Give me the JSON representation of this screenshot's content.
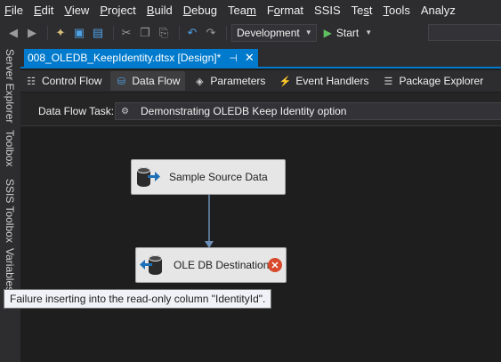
{
  "menu": {
    "items": [
      {
        "pre": "",
        "u": "F",
        "post": "ile"
      },
      {
        "pre": "",
        "u": "E",
        "post": "dit"
      },
      {
        "pre": "",
        "u": "V",
        "post": "iew"
      },
      {
        "pre": "",
        "u": "P",
        "post": "roject"
      },
      {
        "pre": "",
        "u": "B",
        "post": "uild"
      },
      {
        "pre": "",
        "u": "D",
        "post": "ebug"
      },
      {
        "pre": "Tea",
        "u": "m",
        "post": ""
      },
      {
        "pre": "F",
        "u": "o",
        "post": "rmat"
      },
      {
        "pre": "SSIS",
        "u": "",
        "post": ""
      },
      {
        "pre": "Te",
        "u": "s",
        "post": "t"
      },
      {
        "pre": "",
        "u": "T",
        "post": "ools"
      },
      {
        "pre": "Analyz",
        "u": "",
        "post": ""
      }
    ]
  },
  "toolbar": {
    "config_value": "Development",
    "start_label": "Start"
  },
  "sidebar": {
    "tabs": [
      "Server Explorer",
      "Toolbox",
      "SSIS Toolbox",
      "Variables"
    ]
  },
  "document_tab": {
    "title": "008_OLEDB_KeepIdentity.dtsx [Design]*",
    "pin_glyph": "⊣",
    "close_glyph": "✕"
  },
  "designer_tabs": [
    {
      "label": "Control Flow",
      "icon": "control-flow-icon",
      "active": false
    },
    {
      "label": "Data Flow",
      "icon": "data-flow-icon",
      "active": true
    },
    {
      "label": "Parameters",
      "icon": "parameters-icon",
      "active": false
    },
    {
      "label": "Event Handlers",
      "icon": "event-handlers-icon",
      "active": false
    },
    {
      "label": "Package Explorer",
      "icon": "package-explorer-icon",
      "active": false
    }
  ],
  "task_bar": {
    "label": "Data Flow Task:",
    "value": "Demonstrating OLEDB Keep Identity option"
  },
  "components": {
    "source": {
      "label": "Sample Source Data",
      "icon": "oledb-source-icon"
    },
    "destination": {
      "label": "OLE DB Destination",
      "icon": "oledb-destination-icon",
      "error": true
    }
  },
  "tooltip": {
    "text": "Failure inserting into the read-only column \"IdentityId\"."
  },
  "colors": {
    "accent": "#007acc",
    "error": "#d84a2b",
    "background": "#1e1e1e",
    "chrome": "#2d2d30"
  }
}
